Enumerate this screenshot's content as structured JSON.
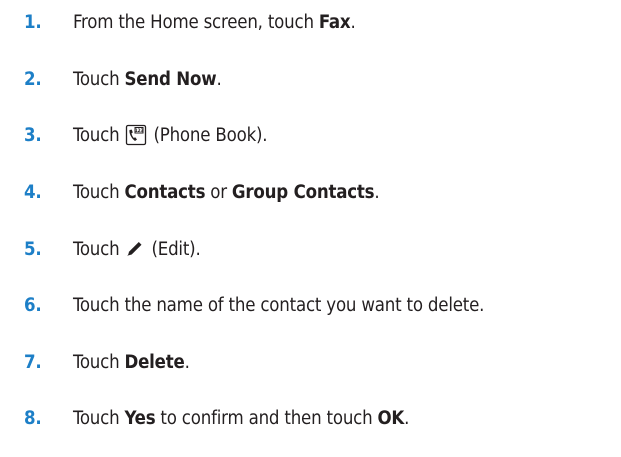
{
  "steps": [
    {
      "num": "1.",
      "t1": "From the Home screen, touch",
      "b1": "Fax",
      "t2": " ."
    },
    {
      "num": "2.",
      "t1": "Touch",
      "b1": "Send Now",
      "t2": "."
    },
    {
      "num": "3.",
      "t1": "Touch",
      "icon": "phone-book-icon",
      "t2": "(Phone Book)."
    },
    {
      "num": "4.",
      "t1": "Touch",
      "b1": "Contacts",
      "t2": "or",
      "b2": "Group Contacts",
      "t3": "."
    },
    {
      "num": "5.",
      "t1": "Touch",
      "icon": "edit-pencil-icon",
      "t2": "(Edit)."
    },
    {
      "num": "6.",
      "t1": "Touch the name of the contact you want to delete."
    },
    {
      "num": "7.",
      "t1": "Touch",
      "b1": "Delete",
      "t2": "."
    },
    {
      "num": "8.",
      "t1": "Touch",
      "b1": "Yes",
      "t2": "to confirm and then touch",
      "b2": "OK",
      "t3": " ."
    }
  ],
  "colors": {
    "number": "#1d7fc7",
    "text": "#231f20"
  }
}
